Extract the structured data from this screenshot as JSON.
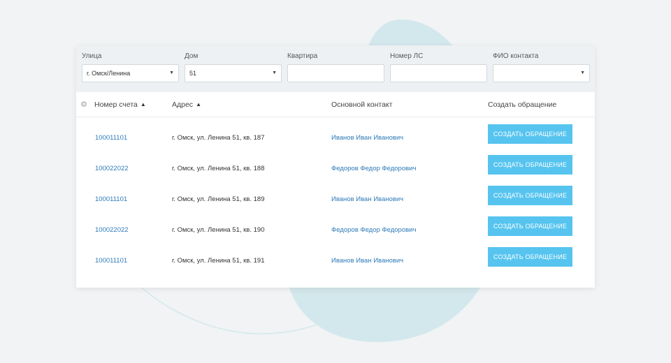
{
  "filters": {
    "street": {
      "label": "Улица",
      "value": "г. Омск/Ленина"
    },
    "house": {
      "label": "Дом",
      "value": "51"
    },
    "apartment": {
      "label": "Квартира",
      "value": ""
    },
    "account": {
      "label": "Номер ЛС",
      "value": ""
    },
    "contact": {
      "label": "ФИО контакта",
      "value": ""
    }
  },
  "table": {
    "headers": {
      "account": "Номер счета",
      "address": "Адрес",
      "contact": "Основной контакт",
      "action": "Создать обращение"
    },
    "rows": [
      {
        "account": "100011101",
        "address": "г. Омск, ул. Ленина 51, кв. 187",
        "contact": "Иванов Иван Иванович",
        "button": "СОЗДАТЬ ОБРАЩЕНИЕ"
      },
      {
        "account": "100022022",
        "address": "г. Омск, ул. Ленина 51, кв. 188",
        "contact": "Федоров Федор Федорович",
        "button": "СОЗДАТЬ ОБРАЩЕНИЕ"
      },
      {
        "account": "100011101",
        "address": "г. Омск, ул. Ленина 51, кв. 189",
        "contact": "Иванов Иван Иванович",
        "button": "СОЗДАТЬ ОБРАЩЕНИЕ"
      },
      {
        "account": "100022022",
        "address": "г. Омск, ул. Ленина 51, кв. 190",
        "contact": "Федоров Федор Федорович",
        "button": "СОЗДАТЬ ОБРАЩЕНИЕ"
      },
      {
        "account": "100011101",
        "address": "г. Омск, ул. Ленина 51, кв. 191",
        "contact": "Иванов Иван Иванович",
        "button": "СОЗДАТЬ ОБРАЩЕНИЕ"
      }
    ]
  },
  "icons": {
    "settings": "gear-icon",
    "sort": "chevron-up-icon",
    "dropdown": "caret-down-icon"
  },
  "colors": {
    "accent_button": "#56c4ef",
    "link": "#2d7ab8",
    "background": "#f1f3f4",
    "filter_bar": "#edf1f4"
  }
}
